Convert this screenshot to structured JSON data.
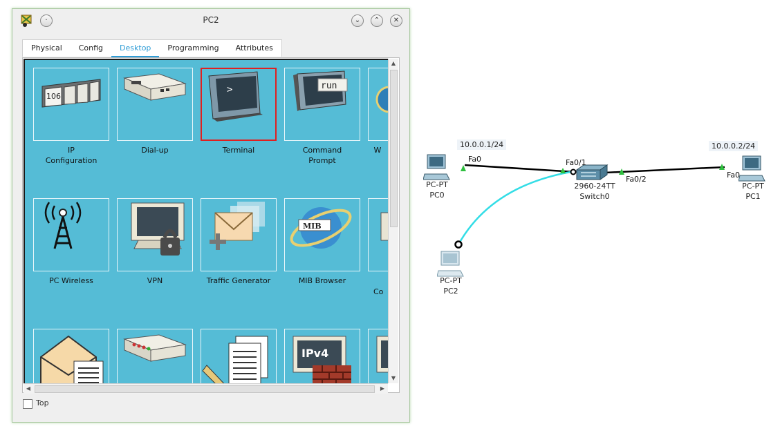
{
  "window": {
    "title": "PC2",
    "controls": [
      "v",
      "^",
      "x"
    ]
  },
  "tabs": [
    {
      "label": "Physical"
    },
    {
      "label": "Config"
    },
    {
      "label": "Desktop",
      "active": true
    },
    {
      "label": "Programming"
    },
    {
      "label": "Attributes"
    }
  ],
  "desktop": {
    "row1": [
      {
        "line1": "IP",
        "line2": "Configuration",
        "icon": "ip-config-icon",
        "badge": "106"
      },
      {
        "line1": "Dial-up",
        "line2": "",
        "icon": "dialup-modem-icon"
      },
      {
        "line1": "Terminal",
        "line2": "",
        "icon": "terminal-icon",
        "prompt": ">",
        "selected": true
      },
      {
        "line1": "Command",
        "line2": "Prompt",
        "icon": "command-prompt-icon",
        "prompt": "run"
      },
      {
        "line1": "W",
        "line2": "",
        "icon": "web-browser-icon"
      }
    ],
    "row2": [
      {
        "label": "PC Wireless",
        "icon": "wireless-tower-icon"
      },
      {
        "label": "VPN",
        "icon": "vpn-lock-icon"
      },
      {
        "label": "Traffic Generator",
        "icon": "traffic-generator-icon"
      },
      {
        "label": "MIB Browser",
        "icon": "mib-browser-icon",
        "badge": "MIB"
      },
      {
        "label": "Co",
        "icon": "cisco-ip-communicator-icon"
      }
    ],
    "row3": [
      {
        "icon": "email-icon"
      },
      {
        "icon": "pppoe-dialer-icon"
      },
      {
        "icon": "text-editor-icon"
      },
      {
        "icon": "firewall-icon",
        "badge": "IPv4"
      },
      {
        "icon": "firewall-ipv6-icon"
      }
    ]
  },
  "footer": {
    "top_label": "Top",
    "top_checked": false
  },
  "topology": {
    "devices": [
      {
        "id": "pc0",
        "type": "PC-PT",
        "name": "PC0",
        "ip": "10.0.0.1/24",
        "port": "Fa0"
      },
      {
        "id": "switch0",
        "type": "2960-24TT",
        "name": "Switch0",
        "ports": [
          "Fa0/1",
          "Fa0/2"
        ]
      },
      {
        "id": "pc1",
        "type": "PC-PT",
        "name": "PC1",
        "ip": "10.0.0.2/24",
        "port": "Fa0"
      },
      {
        "id": "pc2",
        "type": "PC-PT",
        "name": "PC2"
      }
    ],
    "colors": {
      "link": "#000000",
      "console_link": "#33dde6",
      "link_up": "#2fbf3f"
    }
  }
}
